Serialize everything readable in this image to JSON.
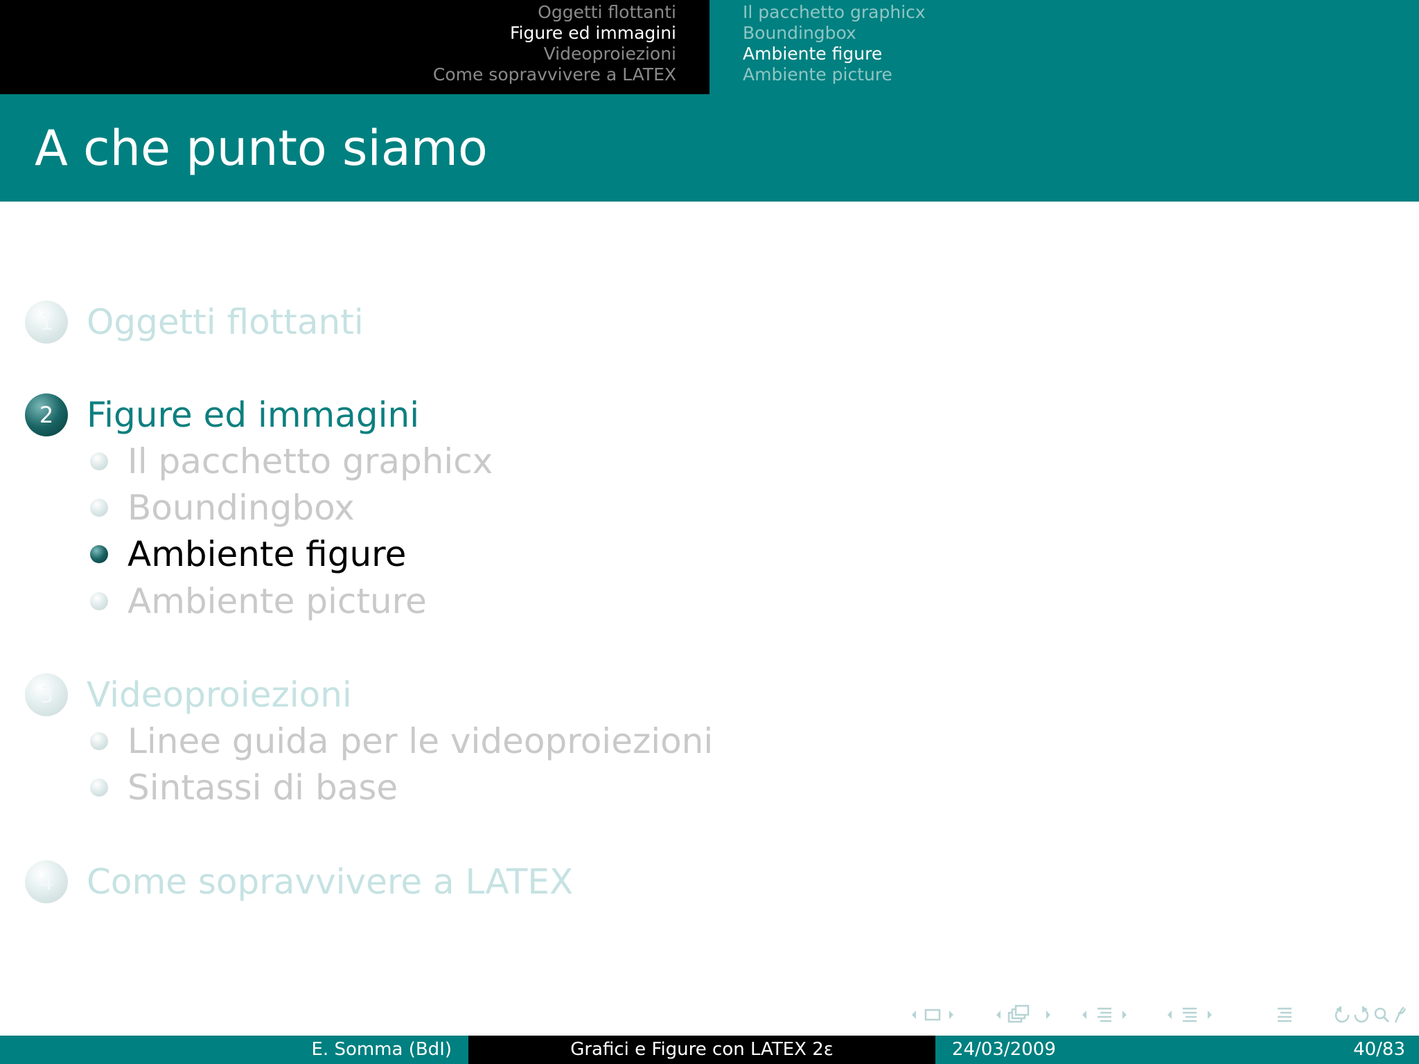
{
  "header": {
    "sections": [
      {
        "label": "Oggetti flottanti",
        "active": false
      },
      {
        "label": "Figure ed immagini",
        "active": true
      },
      {
        "label": "Videoproiezioni",
        "active": false
      },
      {
        "label": "Come sopravvivere a LATEX",
        "active": false
      }
    ],
    "subsections": [
      {
        "label": "Il pacchetto graphicx",
        "active": false
      },
      {
        "label": "Boundingbox",
        "active": false
      },
      {
        "label": "Ambiente figure",
        "active": true
      },
      {
        "label": "Ambiente picture",
        "active": false
      }
    ]
  },
  "frame": {
    "title": "A che punto siamo"
  },
  "outline": {
    "sections": [
      {
        "number": "1",
        "label": "Oggetti flottanti",
        "state": "dim",
        "subsections": []
      },
      {
        "number": "2",
        "label": "Figure ed immagini",
        "state": "active",
        "subsections": [
          {
            "label": "Il pacchetto graphicx",
            "state": "dim"
          },
          {
            "label": "Boundingbox",
            "state": "dim"
          },
          {
            "label": "Ambiente figure",
            "state": "active"
          },
          {
            "label": "Ambiente picture",
            "state": "dim"
          }
        ]
      },
      {
        "number": "3",
        "label": "Videoproiezioni",
        "state": "dim",
        "subsections": [
          {
            "label": "Linee guida per le videoproiezioni",
            "state": "dim"
          },
          {
            "label": "Sintassi di base",
            "state": "dim"
          }
        ]
      },
      {
        "number": "4",
        "label": "Come sopravvivere a LATEX",
        "state": "dim",
        "subsections": []
      }
    ]
  },
  "footer": {
    "author": "E. Somma (BdI)",
    "title": "Grafici e Figure con LATEX 2ε",
    "date": "24/03/2009",
    "page": "40/83"
  },
  "colors": {
    "accent": "#008080",
    "header_dark": "#000000",
    "active_text": "#0e7f7f"
  }
}
